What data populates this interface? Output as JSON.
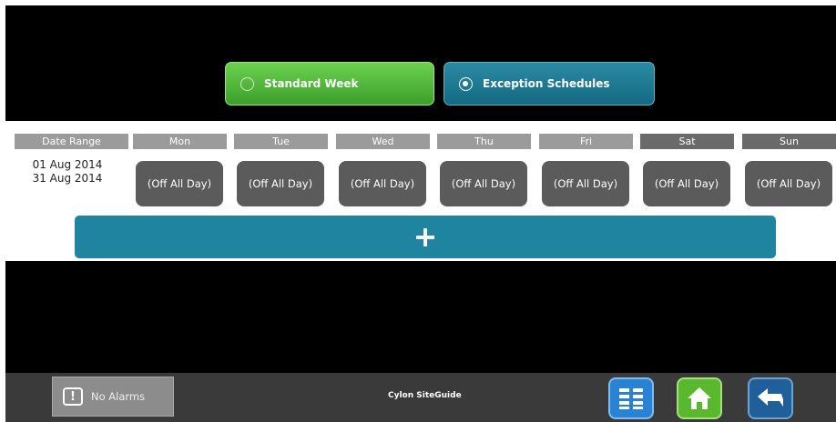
{
  "mode_toggle": {
    "standard_week": "Standard Week",
    "exception_schedules": "Exception Schedules",
    "selected": "Exception Schedules"
  },
  "schedule": {
    "headers": {
      "date_range": "Date Range",
      "days": [
        "Mon",
        "Tue",
        "Wed",
        "Thu",
        "Fri",
        "Sat",
        "Sun"
      ]
    },
    "row": {
      "start_date": "01 Aug 2014",
      "end_date": "31 Aug 2014",
      "days": [
        "(Off All Day)",
        "(Off All Day)",
        "(Off All Day)",
        "(Off All Day)",
        "(Off All Day)",
        "(Off All Day)",
        "(Off All Day)"
      ]
    },
    "add_button_symbol": "+"
  },
  "bottom_bar": {
    "alarm_label": "No Alarms",
    "alarm_icon_glyph": "!",
    "brand": "Cylon SiteGuide"
  },
  "icons": {
    "radio_off": "radio-unselected-icon",
    "radio_on": "radio-selected-icon",
    "alarm": "alarm-icon",
    "list": "list-icon",
    "home": "home-icon",
    "back": "back-arrow-icon",
    "add": "plus-icon"
  },
  "colors": {
    "standard_week_bg": "#4fb83a",
    "exception_bg": "#1c7a92",
    "add_button_bg": "#1f84a0",
    "day_button_bg": "#5b5b5b",
    "weekday_header_bg": "#9b9b9b",
    "weekend_header_bg": "#6a6a6a",
    "bottom_bar_bg": "#3a3a3a"
  }
}
